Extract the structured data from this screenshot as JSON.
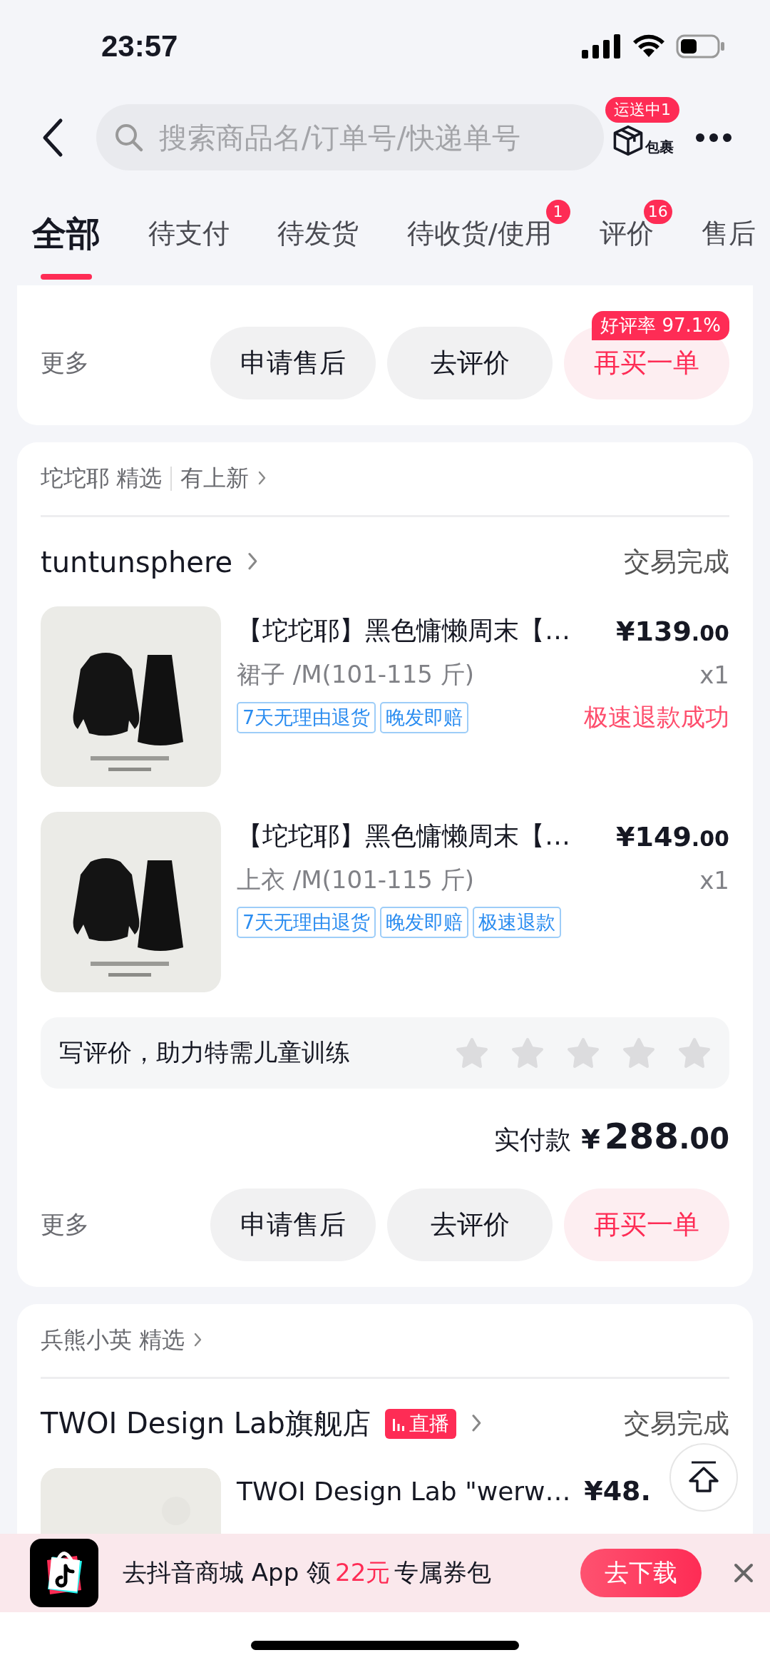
{
  "status_bar": {
    "time": "23:57"
  },
  "header": {
    "search": {
      "placeholder": "搜索商品名/订单号/快递单号"
    },
    "package": {
      "label": "包裹",
      "badge": "运送中1"
    }
  },
  "tabs": [
    {
      "label": "全部",
      "selected": true
    },
    {
      "label": "待支付",
      "selected": false
    },
    {
      "label": "待发货",
      "selected": false
    },
    {
      "label": "待收货/使用",
      "selected": false,
      "badge": "1"
    },
    {
      "label": "评价",
      "selected": false,
      "badge": "16"
    },
    {
      "label": "售后",
      "selected": false
    }
  ],
  "orders": [
    {
      "more": "更多",
      "buttons": [
        {
          "label": "申请售后",
          "kind": "plain"
        },
        {
          "label": "去评价",
          "kind": "plain"
        },
        {
          "label": "再买一单",
          "kind": "primary",
          "tag": "好评率 97.1%"
        }
      ]
    },
    {
      "source": {
        "name": "坨坨耶 精选",
        "extra": "有上新"
      },
      "store": {
        "name": "tuntunsphere",
        "status": "交易完成"
      },
      "items": [
        {
          "title": "【坨坨耶】黑色慵懒周末【…",
          "price": "¥139.00",
          "spec": "裙子 /M(101-115 斤)",
          "qty": "x1",
          "tags": [
            "7天无理由退货",
            "晚发即赔"
          ],
          "status": "极速退款成功"
        },
        {
          "title": "【坨坨耶】黑色慵懒周末【…",
          "price": "¥149.00",
          "spec": "上衣 /M(101-115 斤)",
          "qty": "x1",
          "tags": [
            "7天无理由退货",
            "晚发即赔",
            "极速退款"
          ]
        }
      ],
      "review": {
        "prompt": "写评价，助力特需儿童训练",
        "stars": 0
      },
      "total": {
        "label": "实付款",
        "amount": "¥288.00"
      },
      "more": "更多",
      "buttons": [
        {
          "label": "申请售后",
          "kind": "plain"
        },
        {
          "label": "去评价",
          "kind": "plain"
        },
        {
          "label": "再买一单",
          "kind": "primary"
        }
      ]
    },
    {
      "source": {
        "name": "兵熊小英 精选"
      },
      "store": {
        "name": "TWOI Design Lab旗舰店",
        "live": "直播",
        "status": "交易完成"
      },
      "items": [
        {
          "kind": "blank",
          "title": "TWOI Design Lab \"werw…",
          "price": "¥48."
        }
      ]
    }
  ],
  "banner": {
    "before": "去抖音商城 App 领",
    "highlight": "22元",
    "after": "专属券包",
    "button": "去下载"
  }
}
